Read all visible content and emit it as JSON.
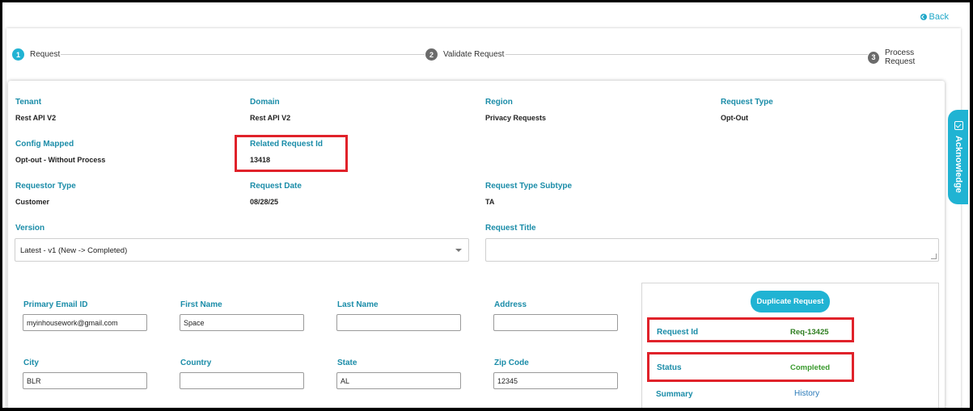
{
  "header": {
    "back_label": "Back"
  },
  "stepper": {
    "steps": [
      {
        "number": "1",
        "label": "Request"
      },
      {
        "number": "2",
        "label": "Validate Request"
      },
      {
        "number": "3",
        "label": "Process Request"
      }
    ]
  },
  "details": {
    "tenant": {
      "label": "Tenant",
      "value": "Rest API V2"
    },
    "domain": {
      "label": "Domain",
      "value": "Rest API V2"
    },
    "region": {
      "label": "Region",
      "value": "Privacy Requests"
    },
    "request_type": {
      "label": "Request Type",
      "value": "Opt-Out"
    },
    "config_mapped": {
      "label": "Config Mapped",
      "value": "Opt-out - Without Process"
    },
    "related_request_id": {
      "label": "Related Request Id",
      "value": "13418"
    },
    "requestor_type": {
      "label": "Requestor Type",
      "value": "Customer"
    },
    "request_date": {
      "label": "Request Date",
      "value": "08/28/25"
    },
    "request_type_subtype": {
      "label": "Request Type Subtype",
      "value": "TA"
    },
    "version": {
      "label": "Version",
      "value": "Latest - v1 (New -> Completed)"
    },
    "request_title": {
      "label": "Request Title",
      "value": ""
    }
  },
  "form": {
    "primary_email": {
      "label": "Primary Email ID",
      "value": "myinhousework@gmail.com"
    },
    "first_name": {
      "label": "First Name",
      "value": "Space"
    },
    "last_name": {
      "label": "Last Name",
      "value": ""
    },
    "address": {
      "label": "Address",
      "value": ""
    },
    "city": {
      "label": "City",
      "value": "BLR"
    },
    "country": {
      "label": "Country",
      "value": ""
    },
    "state": {
      "label": "State",
      "value": "AL"
    },
    "zip_code": {
      "label": "Zip Code",
      "value": "12345"
    }
  },
  "panel": {
    "duplicate_button": "Duplicate Request",
    "request_id": {
      "label": "Request Id",
      "value": "Req-13425"
    },
    "status": {
      "label": "Status",
      "value": "Completed"
    },
    "summary_label": "Summary",
    "history_link": "History"
  },
  "side_tab": {
    "label": "Acknowledge",
    "icon": "check-square-icon"
  },
  "colors": {
    "accent": "#20b3d3",
    "label": "#1a8ca8",
    "status_green": "#3a9a2e",
    "highlight": "#e0222a"
  }
}
